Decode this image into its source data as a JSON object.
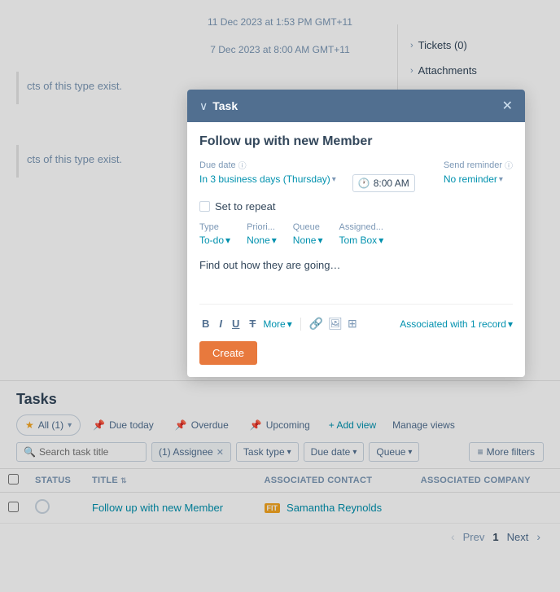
{
  "background": {
    "timestamp1": "11 Dec 2023 at 1:53 PM GMT+11",
    "timestamp2": "7 Dec 2023 at 8:00 AM GMT+11",
    "empty_text": "cts of this type exist."
  },
  "right_panel": {
    "items": [
      {
        "label": "Tickets (0)"
      },
      {
        "label": "Attachments"
      }
    ]
  },
  "task_modal": {
    "header_title": "Task",
    "task_title": "Follow up with new Member",
    "due_date_label": "Due date",
    "due_date_info": "ℹ",
    "due_date_value": "In 3 business days (Thursday)",
    "time_value": "8:00 AM",
    "send_reminder_label": "Send reminder",
    "send_reminder_info": "ℹ",
    "send_reminder_value": "No reminder",
    "repeat_label": "Set to repeat",
    "type_label": "Type",
    "type_value": "To-do",
    "priority_label": "Priori...",
    "priority_value": "None",
    "queue_label": "Queue",
    "queue_value": "None",
    "assigned_label": "Assigned...",
    "assigned_value": "Tom Box",
    "notes_text": "Find out how they are going…",
    "toolbar": {
      "bold": "B",
      "italic": "I",
      "underline": "U",
      "strikethrough": "T",
      "more_label": "More",
      "link_icon": "🔗",
      "image_icon": "🖼",
      "table_icon": "⊞"
    },
    "associated_label": "Associated with 1 record",
    "create_button": "Create"
  },
  "tasks_section": {
    "header": "Tasks",
    "tabs": [
      {
        "label": "All (1)",
        "icon": "★",
        "active": true
      },
      {
        "label": "Due today",
        "icon": "📌"
      },
      {
        "label": "Overdue",
        "icon": "📌"
      },
      {
        "label": "Upcoming",
        "icon": "📌"
      }
    ],
    "add_view": "+ Add view",
    "manage_views": "Manage views",
    "filters": {
      "search_placeholder": "Search task title",
      "assignee_filter": "(1) Assignee",
      "task_type_filter": "Task type",
      "due_date_filter": "Due date",
      "queue_filter": "Queue",
      "more_filters": "≡ More filters"
    },
    "table": {
      "columns": [
        "STATUS",
        "TITLE",
        "ASSOCIATED CONTACT",
        "ASSOCIATED COMPANY"
      ],
      "rows": [
        {
          "status": "",
          "title": "Follow up with new Member",
          "contact_badge": "FIT",
          "contact_name": "Samantha Reynolds",
          "company": ""
        }
      ]
    },
    "pagination": {
      "prev": "Prev",
      "page": "1",
      "next": "Next"
    }
  }
}
